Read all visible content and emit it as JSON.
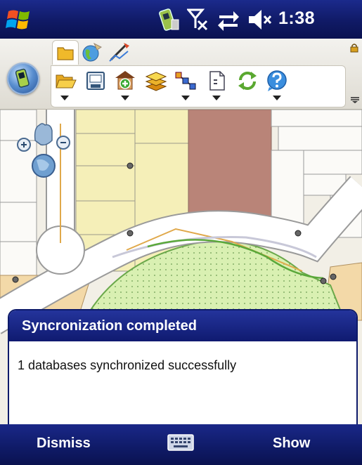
{
  "statusbar": {
    "time": "1:38",
    "icons": [
      "windows-start-icon",
      "phone-battery-icon",
      "no-signal-icon",
      "sync-arrows-icon",
      "speaker-mute-icon"
    ]
  },
  "toolbar": {
    "tabs": [
      "folder-tab-icon",
      "globe-tab-icon",
      "edit-tab-icon"
    ],
    "tools": [
      "open-folder-icon",
      "save-icon",
      "add-layer-icon",
      "layers-icon",
      "nodes-icon",
      "document-icon",
      "refresh-icon",
      "help-icon"
    ]
  },
  "notification": {
    "title": "Syncronization completed",
    "message": "1 databases synchronized successfully"
  },
  "softkeys": {
    "left": "Dismiss",
    "right": "Show"
  },
  "colors": {
    "titlebar": "#101a66",
    "parcel_yellow": "#f5efb8",
    "parcel_brown": "#b98478",
    "parcel_green": "#d8f0b0",
    "parcel_orange": "#f3d9a8",
    "road_white": "#ffffff"
  }
}
